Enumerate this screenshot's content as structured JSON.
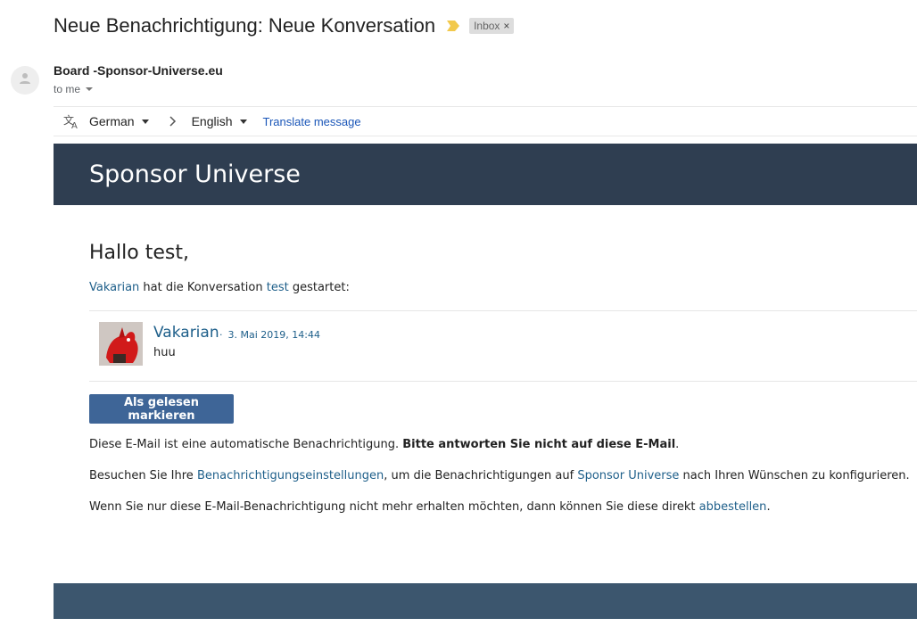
{
  "message": {
    "subject": "Neue Benachrichtigung: Neue Konversation",
    "label": "Inbox",
    "sender": "Board -Sponsor-Universe.eu",
    "recipient": "to me"
  },
  "translate": {
    "source_lang": "German",
    "target_lang": "English",
    "link_label": "Translate message"
  },
  "email": {
    "banner_title": "Sponsor Universe",
    "greeting": "Hallo test,",
    "intro": {
      "user_link": "Vakarian",
      "middle": " hat die Konversation ",
      "conversation_link": "test",
      "end": " gestartet:"
    },
    "post": {
      "author": "Vakarian",
      "separator": "·",
      "date": "3. Mai 2019, 14:44",
      "text": "huu"
    },
    "button_label": "Als gelesen markieren",
    "notice": {
      "normal": "Diese E-Mail ist eine automatische Benachrichtigung. ",
      "bold": "Bitte antworten Sie nicht auf diese E-Mail",
      "end": "."
    },
    "settings": {
      "before": "Besuchen Sie Ihre ",
      "settings_link": "Benachrichtigungseinstellungen",
      "middle": ", um die Benachrichtigungen auf ",
      "site_link": "Sponsor Universe",
      "end": " nach Ihren Wünschen zu konfigurieren."
    },
    "unsubscribe": {
      "before": "Wenn Sie nur diese E-Mail-Benachrichtigung nicht mehr erhalten möchten, dann können Sie diese direkt ",
      "link": "abbestellen",
      "end": "."
    }
  },
  "colors": {
    "banner": "#2f3e51",
    "footer": "#3c566e",
    "button": "#3e6597",
    "link": "#1e5f8a",
    "importance": "#f2c94c"
  },
  "icons": [
    "importance-marker-icon",
    "close-icon",
    "person-icon",
    "translate-icon",
    "chevron-right-icon",
    "caret-down-icon"
  ]
}
